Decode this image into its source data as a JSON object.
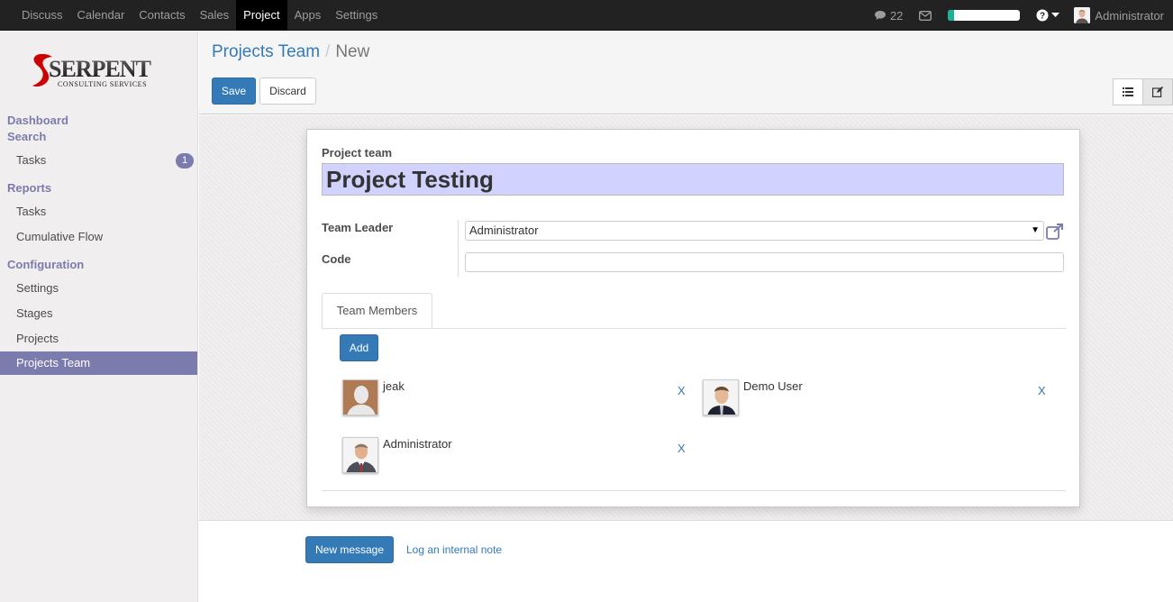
{
  "topbar": {
    "menu": [
      "Discuss",
      "Calendar",
      "Contacts",
      "Sales",
      "Project",
      "Apps",
      "Settings"
    ],
    "active_menu": "Project",
    "messages_count": "22",
    "user_name": "Administrator",
    "progress": 0.08
  },
  "logo": {
    "main": "SERPENT",
    "sub": "CONSULTING SERVICES"
  },
  "sidebar": {
    "dashboard": "Dashboard",
    "search": "Search",
    "tasks": "Tasks",
    "tasks_badge": "1",
    "reports": "Reports",
    "reports_tasks": "Tasks",
    "cumulative_flow": "Cumulative Flow",
    "configuration": "Configuration",
    "settings": "Settings",
    "stages": "Stages",
    "projects": "Projects",
    "projects_team": "Projects Team"
  },
  "breadcrumb": {
    "parent": "Projects Team",
    "sep": "/",
    "current": "New"
  },
  "buttons": {
    "save": "Save",
    "discard": "Discard",
    "add": "Add",
    "new_message": "New message",
    "log_note": "Log an internal note"
  },
  "form": {
    "project_team_label": "Project team",
    "project_team_value": "Project Testing",
    "team_leader_label": "Team Leader",
    "team_leader_value": "Administrator",
    "code_label": "Code",
    "code_value": "",
    "tab_label": "Team Members",
    "members": [
      {
        "name": "jeak",
        "remove": "X"
      },
      {
        "name": "Demo User",
        "remove": "X"
      },
      {
        "name": "Administrator",
        "remove": "X"
      }
    ]
  },
  "colors": {
    "accent": "#7c7bad",
    "primary": "#337ab7",
    "title_bg": "#d2d2ff"
  }
}
